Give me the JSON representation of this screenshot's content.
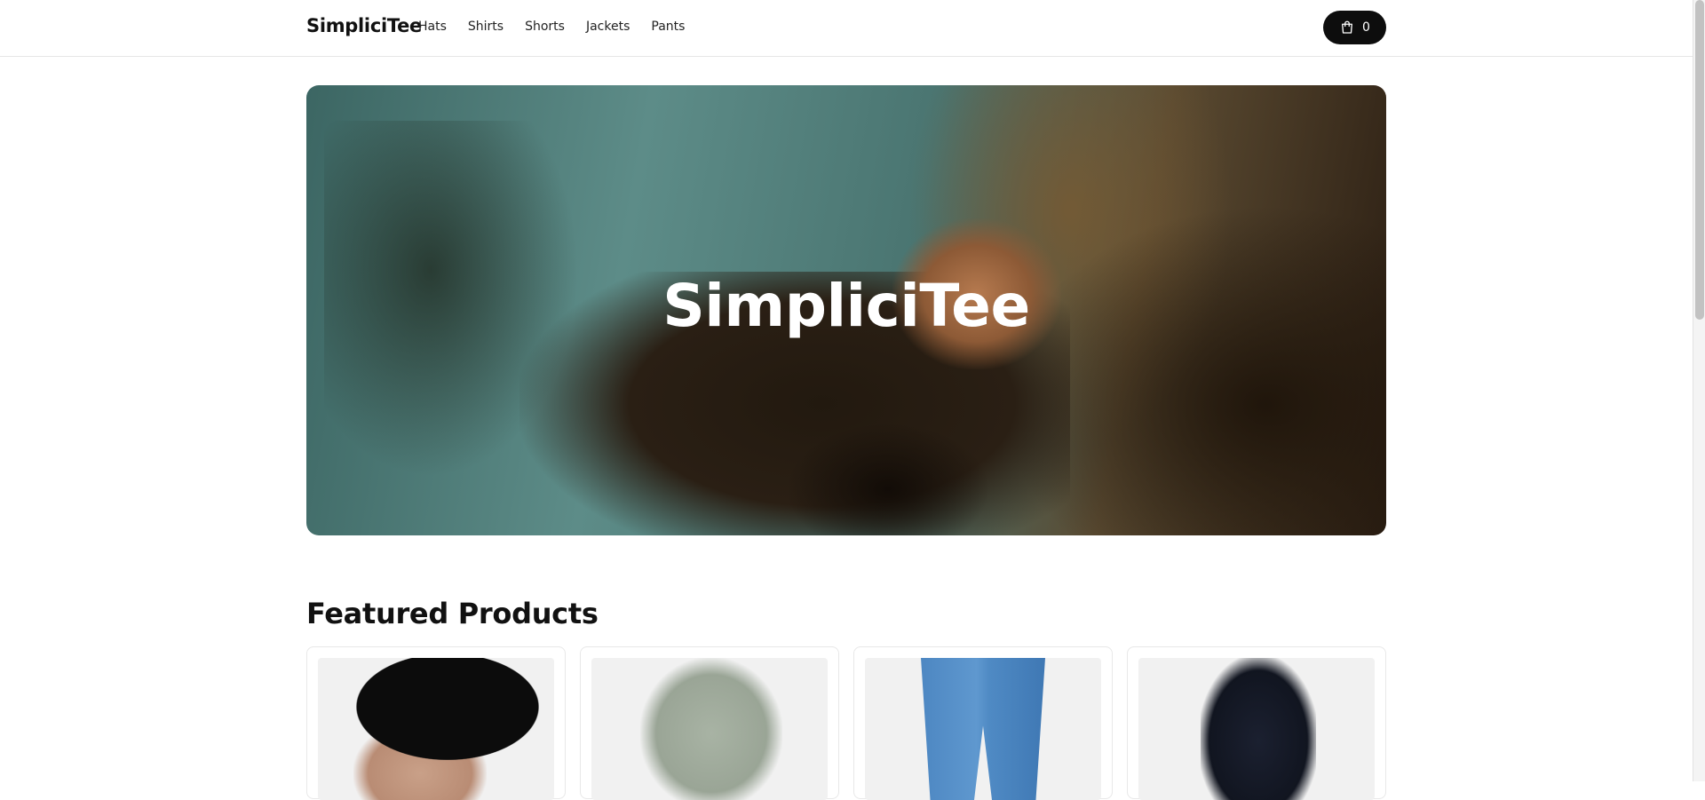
{
  "header": {
    "logo": "SimpliciTee",
    "nav": [
      {
        "label": "Hats"
      },
      {
        "label": "Shirts"
      },
      {
        "label": "Shorts"
      },
      {
        "label": "Jackets"
      },
      {
        "label": "Pants"
      }
    ],
    "cart": {
      "icon": "shopping-bag-icon",
      "count": "0"
    }
  },
  "hero": {
    "title": "SimpliciTee"
  },
  "featured": {
    "title": "Featured Products",
    "products": [
      {
        "image": "bucket-hat-image"
      },
      {
        "image": "green-shirt-image"
      },
      {
        "image": "blue-jeans-image"
      },
      {
        "image": "dark-jacket-image"
      }
    ]
  }
}
